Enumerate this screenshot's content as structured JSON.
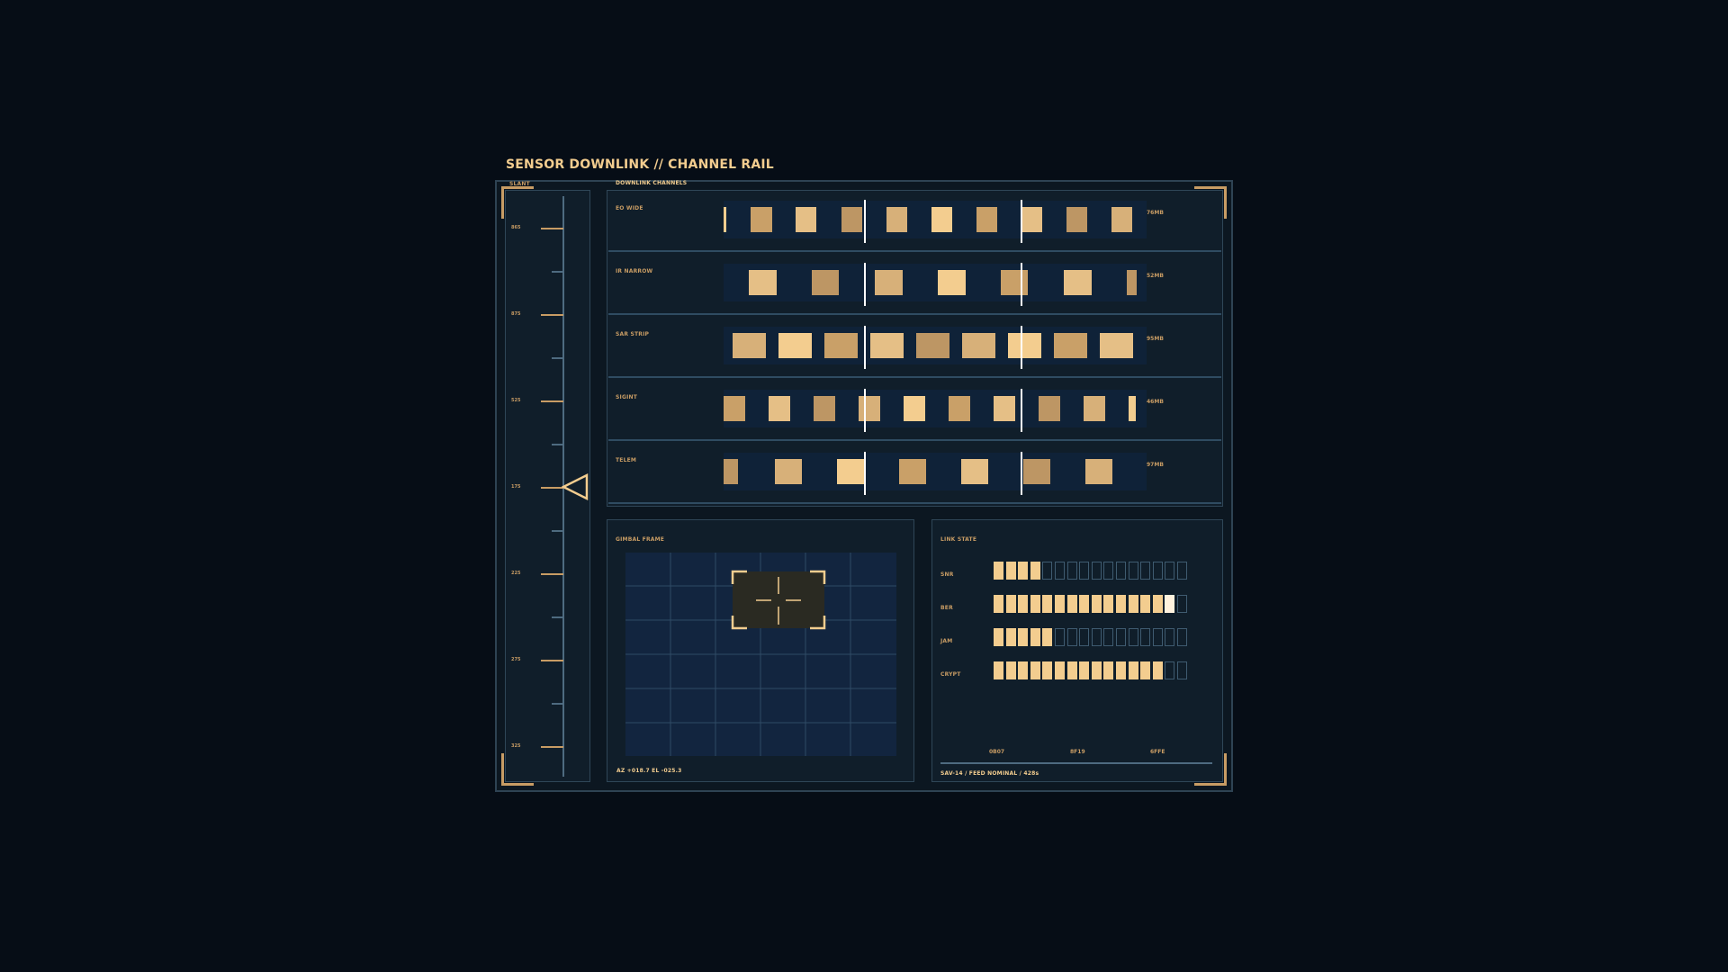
{
  "header": {
    "title": "SENSOR DOWNLINK // CHANNEL RAIL"
  },
  "colors": {
    "accent": "#c89c64",
    "text": "#f3cd8f",
    "rail_line": "#4e6b80",
    "lane": "#0f2238",
    "grid_bg": "#12253f",
    "grid_line": "#2f4a66",
    "reticle_box": "#2a2a22",
    "seg_empty": "#3f5b70",
    "divider": "#2f4c62",
    "white": "#ffffff"
  },
  "rail": {
    "label": "SLANT",
    "ticks": [
      "865",
      "875",
      "525",
      "175",
      "225",
      "275",
      "325"
    ],
    "marker_value": "175"
  },
  "channels": {
    "label": "DOWNLINK CHANNELS",
    "rows": [
      {
        "name": "EO WIDE",
        "rate": "76MB"
      },
      {
        "name": "IR NARROW",
        "rate": "52MB"
      },
      {
        "name": "SAR STRIP",
        "rate": "95MB"
      },
      {
        "name": "SIGINT",
        "rate": "46MB"
      },
      {
        "name": "TELEM",
        "rate": "97MB"
      }
    ]
  },
  "gimbal": {
    "label": "GIMBAL FRAME",
    "readout": "AZ +018.7 EL -025.3"
  },
  "link_state": {
    "label": "LINK STATE",
    "segments_total": 16,
    "meters": [
      {
        "name": "SNR",
        "filled": 4
      },
      {
        "name": "BER",
        "filled": 15
      },
      {
        "name": "JAM",
        "filled": 5
      },
      {
        "name": "CRYPT",
        "filled": 14
      }
    ],
    "codes": [
      "0B07",
      "8F19",
      "6FFE"
    ],
    "footer": "SAV-14 / FEED NOMINAL / 428s"
  }
}
